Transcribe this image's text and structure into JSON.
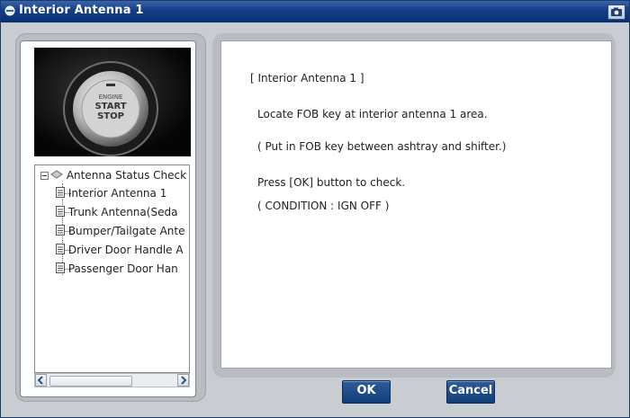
{
  "window": {
    "title": "Interior Antenna 1"
  },
  "photo": {
    "button_text_lines": [
      "ENGINE",
      "START",
      "STOP"
    ]
  },
  "tree": {
    "root_label": "Antenna Status Check",
    "items": [
      {
        "label": "Interior Antenna 1"
      },
      {
        "label": "Trunk Antenna(Seda"
      },
      {
        "label": "Bumper/Tailgate Ante"
      },
      {
        "label": "Driver Door Handle A"
      },
      {
        "label": "Passenger Door Han"
      }
    ]
  },
  "content": {
    "lines": [
      "[ Interior Antenna 1 ]",
      "Locate FOB key at interior antenna 1 area.",
      "( Put in FOB key between ashtray and shifter.)",
      "Press [OK] button to check.",
      "( CONDITION : IGN OFF )"
    ]
  },
  "buttons": {
    "ok_label": "OK",
    "cancel_label": "Cancel"
  },
  "colors": {
    "title_bar": "#123d86",
    "button": "#1c4682",
    "frame": "#b9bcc2"
  }
}
